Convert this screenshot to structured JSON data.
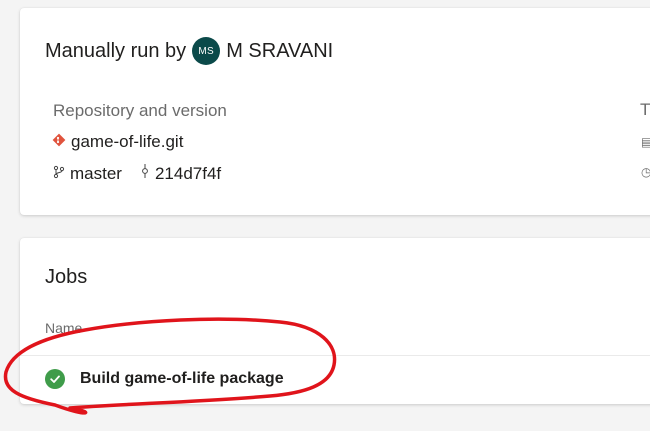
{
  "summary": {
    "run_by_label": "Manually run by",
    "avatar_initials": "MS",
    "user_name": "M SRAVANI",
    "section_label": "Repository and version",
    "repo_name": "game-of-life.git",
    "branch": "master",
    "commit": "214d7f4f",
    "right_column_label": "T"
  },
  "jobs": {
    "title": "Jobs",
    "column_name": "Name",
    "items": [
      {
        "name": "Build game-of-life package",
        "status": "succeeded"
      }
    ]
  },
  "colors": {
    "avatar_bg": "#0b4a4a",
    "git_icon": "#e0533d",
    "success": "#3f9c4a",
    "annotation_red": "#e0141b"
  },
  "icons": {
    "git": "git-diamond-icon",
    "branch": "branch-icon",
    "commit": "commit-icon",
    "status": "check-circle-icon"
  }
}
